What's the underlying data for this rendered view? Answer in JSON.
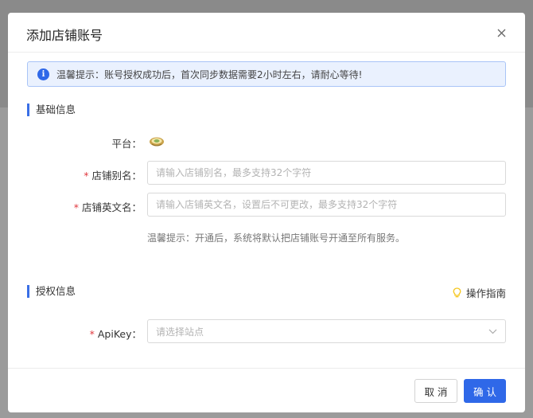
{
  "modal": {
    "title": "添加店铺账号",
    "notice": "温馨提示：账号授权成功后，首次同步数据需要2小时左右，请耐心等待!"
  },
  "basic_section": {
    "title": "基础信息",
    "platform_label": "平台：",
    "alias_label": "店铺别名：",
    "alias_placeholder": "请输入店铺别名，最多支持32个字符",
    "english_label": "店铺英文名：",
    "english_placeholder": "请输入店铺英文名，设置后不可更改，最多支持32个字符",
    "hint": "温馨提示：开通后，系统将默认把店铺账号开通至所有服务。"
  },
  "auth_section": {
    "title": "授权信息",
    "guide_label": "操作指南",
    "apikey_label": "ApiKey：",
    "apikey_placeholder": "请选择站点"
  },
  "footer": {
    "cancel_label": "取 消",
    "confirm_label": "确 认"
  },
  "colors": {
    "accent": "#2f68e8",
    "required": "#e0383e",
    "notice_bg": "#eaf1fe",
    "guide_icon": "#f5c518"
  },
  "icons": {
    "close": "close-icon",
    "info": "info-icon",
    "platform": "platform-logo-icon",
    "guide": "lightbulb-icon",
    "dropdown": "chevron-down-icon"
  }
}
